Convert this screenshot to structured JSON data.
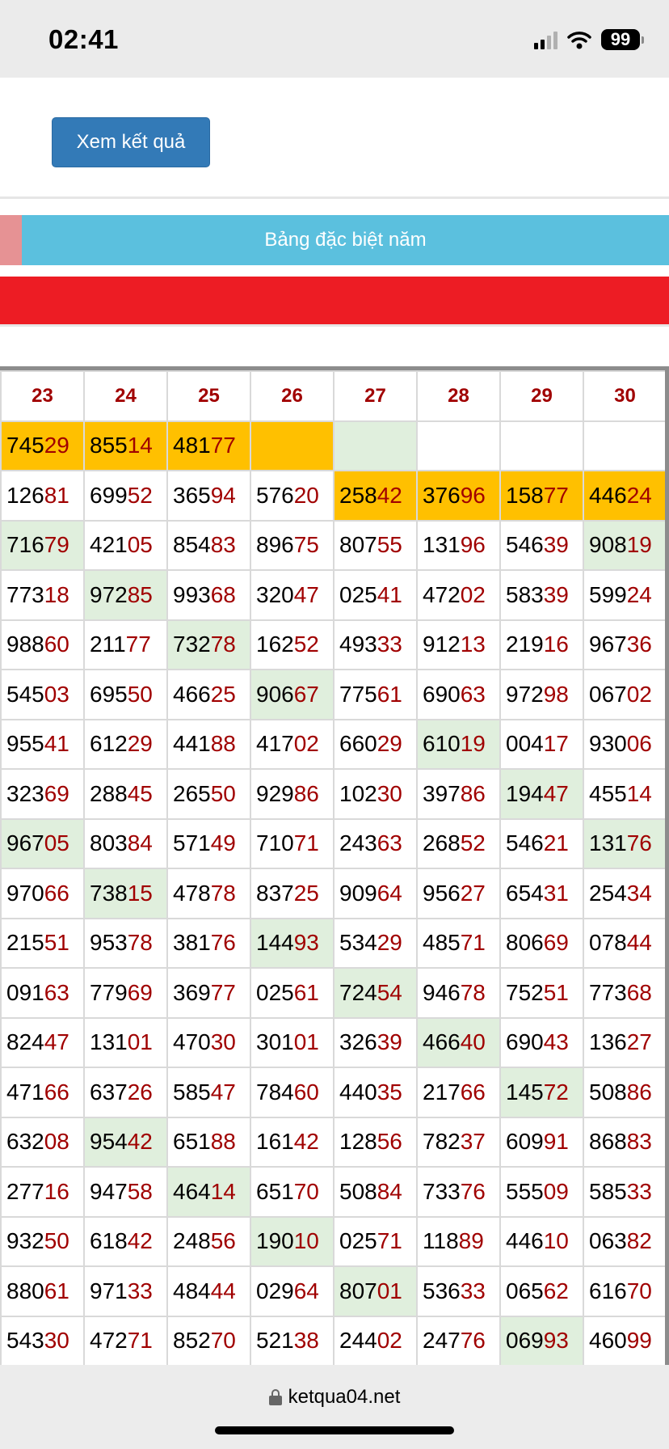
{
  "status_bar": {
    "time": "02:41",
    "battery": "99"
  },
  "form": {
    "submit_label": "Xem kết quả"
  },
  "tabs": {
    "active_label": "Bảng đặc biệt năm"
  },
  "table": {
    "columns": [
      "23",
      "24",
      "25",
      "26",
      "27",
      "28",
      "29",
      "30"
    ],
    "rows": [
      [
        {
          "v": "74529",
          "h": "yellow"
        },
        {
          "v": "85514",
          "h": "yellow"
        },
        {
          "v": "48177",
          "h": "yellow"
        },
        {
          "v": "",
          "h": "yellow"
        },
        {
          "v": "",
          "h": "green"
        },
        {
          "v": "",
          "h": ""
        },
        {
          "v": "",
          "h": ""
        },
        {
          "v": "",
          "h": ""
        }
      ],
      [
        {
          "v": "12681",
          "h": ""
        },
        {
          "v": "69952",
          "h": ""
        },
        {
          "v": "36594",
          "h": ""
        },
        {
          "v": "57620",
          "h": ""
        },
        {
          "v": "25842",
          "h": "yellow"
        },
        {
          "v": "37696",
          "h": "yellow"
        },
        {
          "v": "15877",
          "h": "yellow"
        },
        {
          "v": "44624",
          "h": "yellow"
        }
      ],
      [
        {
          "v": "71679",
          "h": "green"
        },
        {
          "v": "42105",
          "h": ""
        },
        {
          "v": "85483",
          "h": ""
        },
        {
          "v": "89675",
          "h": ""
        },
        {
          "v": "80755",
          "h": ""
        },
        {
          "v": "13196",
          "h": ""
        },
        {
          "v": "54639",
          "h": ""
        },
        {
          "v": "90819",
          "h": "green"
        }
      ],
      [
        {
          "v": "77318",
          "h": ""
        },
        {
          "v": "97285",
          "h": "green"
        },
        {
          "v": "99368",
          "h": ""
        },
        {
          "v": "32047",
          "h": ""
        },
        {
          "v": "02541",
          "h": ""
        },
        {
          "v": "47202",
          "h": ""
        },
        {
          "v": "58339",
          "h": ""
        },
        {
          "v": "59924",
          "h": ""
        }
      ],
      [
        {
          "v": "98860",
          "h": ""
        },
        {
          "v": "21177",
          "h": ""
        },
        {
          "v": "73278",
          "h": "green"
        },
        {
          "v": "16252",
          "h": ""
        },
        {
          "v": "49333",
          "h": ""
        },
        {
          "v": "91213",
          "h": ""
        },
        {
          "v": "21916",
          "h": ""
        },
        {
          "v": "96736",
          "h": ""
        }
      ],
      [
        {
          "v": "54503",
          "h": ""
        },
        {
          "v": "69550",
          "h": ""
        },
        {
          "v": "46625",
          "h": ""
        },
        {
          "v": "90667",
          "h": "green"
        },
        {
          "v": "77561",
          "h": ""
        },
        {
          "v": "69063",
          "h": ""
        },
        {
          "v": "97298",
          "h": ""
        },
        {
          "v": "06702",
          "h": ""
        }
      ],
      [
        {
          "v": "95541",
          "h": ""
        },
        {
          "v": "61229",
          "h": ""
        },
        {
          "v": "44188",
          "h": ""
        },
        {
          "v": "41702",
          "h": ""
        },
        {
          "v": "66029",
          "h": ""
        },
        {
          "v": "61019",
          "h": "green"
        },
        {
          "v": "00417",
          "h": ""
        },
        {
          "v": "93006",
          "h": ""
        }
      ],
      [
        {
          "v": "32369",
          "h": ""
        },
        {
          "v": "28845",
          "h": ""
        },
        {
          "v": "26550",
          "h": ""
        },
        {
          "v": "92986",
          "h": ""
        },
        {
          "v": "10230",
          "h": ""
        },
        {
          "v": "39786",
          "h": ""
        },
        {
          "v": "19447",
          "h": "green"
        },
        {
          "v": "45514",
          "h": ""
        }
      ],
      [
        {
          "v": "96705",
          "h": "green"
        },
        {
          "v": "80384",
          "h": ""
        },
        {
          "v": "57149",
          "h": ""
        },
        {
          "v": "71071",
          "h": ""
        },
        {
          "v": "24363",
          "h": ""
        },
        {
          "v": "26852",
          "h": ""
        },
        {
          "v": "54621",
          "h": ""
        },
        {
          "v": "13176",
          "h": "green"
        }
      ],
      [
        {
          "v": "97066",
          "h": ""
        },
        {
          "v": "73815",
          "h": "green"
        },
        {
          "v": "47878",
          "h": ""
        },
        {
          "v": "83725",
          "h": ""
        },
        {
          "v": "90964",
          "h": ""
        },
        {
          "v": "95627",
          "h": ""
        },
        {
          "v": "65431",
          "h": ""
        },
        {
          "v": "25434",
          "h": ""
        }
      ],
      [
        {
          "v": "21551",
          "h": ""
        },
        {
          "v": "95378",
          "h": ""
        },
        {
          "v": "38176",
          "h": ""
        },
        {
          "v": "14493",
          "h": "green"
        },
        {
          "v": "53429",
          "h": ""
        },
        {
          "v": "48571",
          "h": ""
        },
        {
          "v": "80669",
          "h": ""
        },
        {
          "v": "07844",
          "h": ""
        }
      ],
      [
        {
          "v": "09163",
          "h": ""
        },
        {
          "v": "77969",
          "h": ""
        },
        {
          "v": "36977",
          "h": ""
        },
        {
          "v": "02561",
          "h": ""
        },
        {
          "v": "72454",
          "h": "green"
        },
        {
          "v": "94678",
          "h": ""
        },
        {
          "v": "75251",
          "h": ""
        },
        {
          "v": "77368",
          "h": ""
        }
      ],
      [
        {
          "v": "82447",
          "h": ""
        },
        {
          "v": "13101",
          "h": ""
        },
        {
          "v": "47030",
          "h": ""
        },
        {
          "v": "30101",
          "h": ""
        },
        {
          "v": "32639",
          "h": ""
        },
        {
          "v": "46640",
          "h": "green"
        },
        {
          "v": "69043",
          "h": ""
        },
        {
          "v": "13627",
          "h": ""
        }
      ],
      [
        {
          "v": "47166",
          "h": ""
        },
        {
          "v": "63726",
          "h": ""
        },
        {
          "v": "58547",
          "h": ""
        },
        {
          "v": "78460",
          "h": ""
        },
        {
          "v": "44035",
          "h": ""
        },
        {
          "v": "21766",
          "h": ""
        },
        {
          "v": "14572",
          "h": "green"
        },
        {
          "v": "50886",
          "h": ""
        }
      ],
      [
        {
          "v": "63208",
          "h": ""
        },
        {
          "v": "95442",
          "h": "green"
        },
        {
          "v": "65188",
          "h": ""
        },
        {
          "v": "16142",
          "h": ""
        },
        {
          "v": "12856",
          "h": ""
        },
        {
          "v": "78237",
          "h": ""
        },
        {
          "v": "60991",
          "h": ""
        },
        {
          "v": "86883",
          "h": ""
        }
      ],
      [
        {
          "v": "27716",
          "h": ""
        },
        {
          "v": "94758",
          "h": ""
        },
        {
          "v": "46414",
          "h": "green"
        },
        {
          "v": "65170",
          "h": ""
        },
        {
          "v": "50884",
          "h": ""
        },
        {
          "v": "73376",
          "h": ""
        },
        {
          "v": "55509",
          "h": ""
        },
        {
          "v": "58533",
          "h": ""
        }
      ],
      [
        {
          "v": "93250",
          "h": ""
        },
        {
          "v": "61842",
          "h": ""
        },
        {
          "v": "24856",
          "h": ""
        },
        {
          "v": "19010",
          "h": "green"
        },
        {
          "v": "02571",
          "h": ""
        },
        {
          "v": "11889",
          "h": ""
        },
        {
          "v": "44610",
          "h": ""
        },
        {
          "v": "06382",
          "h": ""
        }
      ],
      [
        {
          "v": "88061",
          "h": ""
        },
        {
          "v": "97133",
          "h": ""
        },
        {
          "v": "48444",
          "h": ""
        },
        {
          "v": "02964",
          "h": ""
        },
        {
          "v": "80701",
          "h": "green"
        },
        {
          "v": "53633",
          "h": ""
        },
        {
          "v": "06562",
          "h": ""
        },
        {
          "v": "61670",
          "h": ""
        }
      ],
      [
        {
          "v": "54330",
          "h": ""
        },
        {
          "v": "47271",
          "h": ""
        },
        {
          "v": "85270",
          "h": ""
        },
        {
          "v": "52138",
          "h": ""
        },
        {
          "v": "24402",
          "h": ""
        },
        {
          "v": "24776",
          "h": ""
        },
        {
          "v": "06993",
          "h": "green"
        },
        {
          "v": "46099",
          "h": ""
        }
      ],
      [
        {
          "v": "",
          "h": "green"
        },
        {
          "v": "",
          "h": ""
        },
        {
          "v": "",
          "h": ""
        },
        {
          "v": "",
          "h": ""
        },
        {
          "v": "",
          "h": ""
        },
        {
          "v": "",
          "h": ""
        },
        {
          "v": "",
          "h": ""
        },
        {
          "v": "",
          "h": "green"
        }
      ]
    ]
  },
  "colors": {
    "yellow": "#ffc000",
    "green": "#e0efdd",
    "tail": "#a00000",
    "tab_active": "#5bc0de",
    "button": "#337ab7",
    "band": "#ed1c24"
  },
  "browser": {
    "url": "ketqua04.net"
  }
}
